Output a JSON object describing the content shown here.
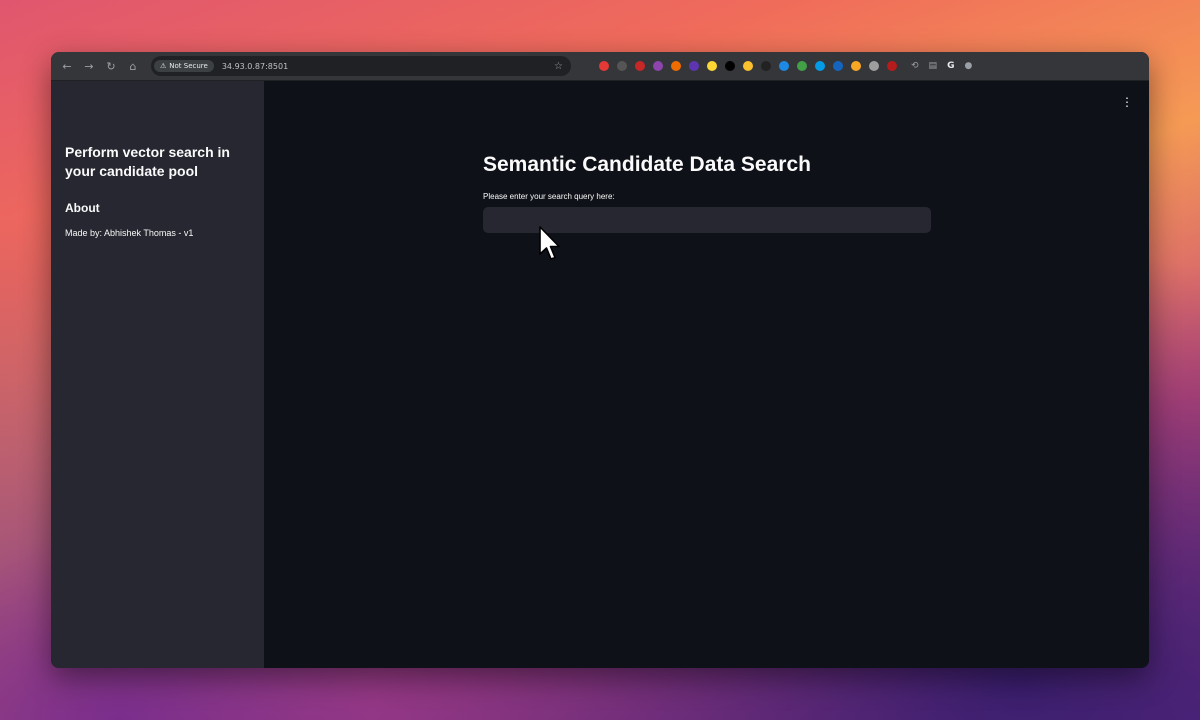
{
  "browser": {
    "security_label": "Not Secure",
    "url": "34.93.0.87:8501",
    "extensions": [
      {
        "name": "ext-red-icon",
        "color": "#e53935"
      },
      {
        "name": "ext-tampermonkey-icon",
        "color": "#555555"
      },
      {
        "name": "ext-redbook-icon",
        "color": "#c62828"
      },
      {
        "name": "ext-purple-icon",
        "color": "#8e44ad"
      },
      {
        "name": "ext-orange-icon",
        "color": "#ef6c00"
      },
      {
        "name": "ext-violet-icon",
        "color": "#5e35b1"
      },
      {
        "name": "ext-yellow-icon",
        "color": "#fdd835"
      },
      {
        "name": "ext-black-icon",
        "color": "#000000"
      },
      {
        "name": "ext-yellow-square-icon",
        "color": "#fbc02d"
      },
      {
        "name": "ext-dark-circle-icon",
        "color": "#222222"
      },
      {
        "name": "ext-blue-icon",
        "color": "#1e88e5"
      },
      {
        "name": "ext-multicolor-icon",
        "color": "#43a047"
      },
      {
        "name": "ext-cyan-icon",
        "color": "#039be5"
      },
      {
        "name": "ext-blue-square-icon",
        "color": "#1565c0"
      },
      {
        "name": "ext-gold-icon",
        "color": "#f9a825"
      },
      {
        "name": "ext-gray-icon",
        "color": "#9e9e9e"
      },
      {
        "name": "ext-dark-red-icon",
        "color": "#b71c1c"
      }
    ]
  },
  "sidebar": {
    "title": "Perform vector search in your candidate pool",
    "about_heading": "About",
    "made_by": "Made by: Abhishek Thomas - v1"
  },
  "main": {
    "title": "Semantic Candidate Data Search",
    "search_label": "Please enter your search query here:",
    "search_value": "",
    "menu_icon": "⋮"
  }
}
